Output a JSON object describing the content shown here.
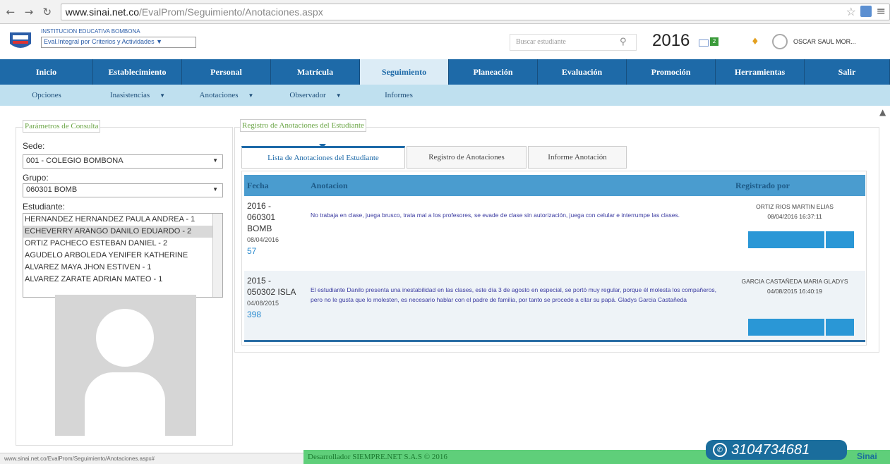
{
  "browser": {
    "url_host": "www.sinai.net.co",
    "url_path": "/EvalProm/Seguimiento/Anotaciones.aspx"
  },
  "header": {
    "institution": "INSTITUCION EDUCATIVA BOMBONA",
    "eval_type": "Eval.Integral por Criterios y Actividades",
    "search_placeholder": "Buscar estudiante",
    "year": "2016",
    "mail_count": "2",
    "user_name": "OSCAR SAUL MOR..."
  },
  "main_nav": [
    {
      "label": "Inicio"
    },
    {
      "label": "Establecimiento"
    },
    {
      "label": "Personal"
    },
    {
      "label": "Matrícula"
    },
    {
      "label": "Seguimiento"
    },
    {
      "label": "Planeación"
    },
    {
      "label": "Evaluación"
    },
    {
      "label": "Promoción"
    },
    {
      "label": "Herramientas"
    },
    {
      "label": "Salir"
    }
  ],
  "sub_nav": [
    {
      "label": "Opciones"
    },
    {
      "label": "Inasistencias"
    },
    {
      "label": "Anotaciones"
    },
    {
      "label": "Observador"
    },
    {
      "label": "Informes"
    }
  ],
  "query": {
    "legend": "Parámetros de Consulta",
    "sede_label": "Sede:",
    "sede_value": "001 - COLEGIO BOMBONA",
    "grupo_label": "Grupo:",
    "grupo_value": "060301 BOMB",
    "estudiante_label": "Estudiante:",
    "students": [
      "HERNANDEZ HERNANDEZ PAULA ANDREA - 1",
      "ECHEVERRY ARANGO DANILO EDUARDO - 2",
      "ORTIZ PACHECO ESTEBAN DANIEL - 2",
      "AGUDELO ARBOLEDA YENIFER KATHERINE",
      "ALVAREZ MAYA JHON ESTIVEN - 1",
      "ALVAREZ ZARATE ADRIAN MATEO - 1"
    ]
  },
  "registro": {
    "legend": "Registro de Anotaciones del Estudiante",
    "tabs": [
      "Lista de Anotaciones del Estudiante",
      "Registro de Anotaciones",
      "Informe Anotación"
    ],
    "columns": [
      "Fecha",
      "Anotacion",
      "Registrado por"
    ],
    "rows": [
      {
        "year": "2016 -",
        "group": "060301",
        "group2": "BOMB",
        "date": "08/04/2016",
        "id": "57",
        "text": "No trabaja en clase, juega brusco, trata mal a los profesores, se evade de clase sin autorización, juega con celular e interrumpe las clases.",
        "registered_by": "ORTIZ RIOS MARTIN ELIAS",
        "registered_at": "08/04/2016 16:37:11"
      },
      {
        "year": "2015 -",
        "group": "050302 ISLA",
        "group2": "",
        "date": "04/08/2015",
        "id": "398",
        "text": "El estudiante Danilo presenta una inestabilidad en las clases, este día 3 de agosto en especial, se portó muy regular, porque él molesta los compañeros, pero no le gusta que lo molesten, es necesario hablar con el padre de familia, por tanto se procede a citar su papá. Gladys Garcia Castañeda",
        "registered_by": "GARCIA CASTAÑEDA MARIA GLADYS",
        "registered_at": "04/08/2015 16:40:19"
      }
    ]
  },
  "footer": {
    "status_url": "www.sinai.net.co/EvalProm/Seguimiento/Anotaciones.aspx#",
    "developer": "Desarrollador SIEMPRE.NET S.A.S © 2016",
    "whatsapp": "3104734681",
    "brand": "Sinai"
  }
}
